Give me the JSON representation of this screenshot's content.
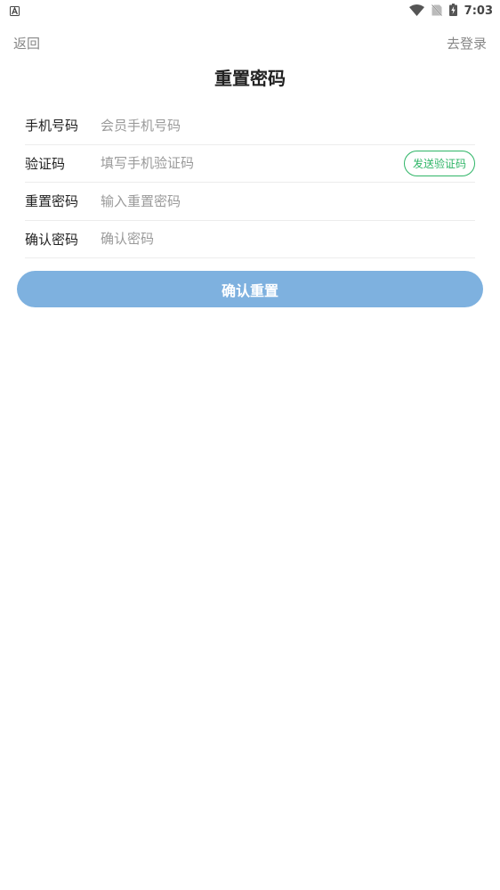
{
  "status_bar": {
    "time": "7:03",
    "icons": [
      "app-a-icon",
      "wifi-icon",
      "no-sim-icon",
      "battery-charging-icon"
    ]
  },
  "nav": {
    "back_label": "返回",
    "login_label": "去登录"
  },
  "page": {
    "title": "重置密码"
  },
  "form": {
    "phone": {
      "label": "手机号码",
      "placeholder": "会员手机号码",
      "value": ""
    },
    "code": {
      "label": "验证码",
      "placeholder": "填写手机验证码",
      "value": "",
      "send_label": "发送验证码"
    },
    "new_password": {
      "label": "重置密码",
      "placeholder": "输入重置密码",
      "value": ""
    },
    "confirm_password": {
      "label": "确认密码",
      "placeholder": "确认密码",
      "value": ""
    }
  },
  "actions": {
    "confirm_label": "确认重置"
  },
  "colors": {
    "accent_green": "#2fb567",
    "button_blue": "#7eb1df",
    "muted_text": "#888888"
  }
}
